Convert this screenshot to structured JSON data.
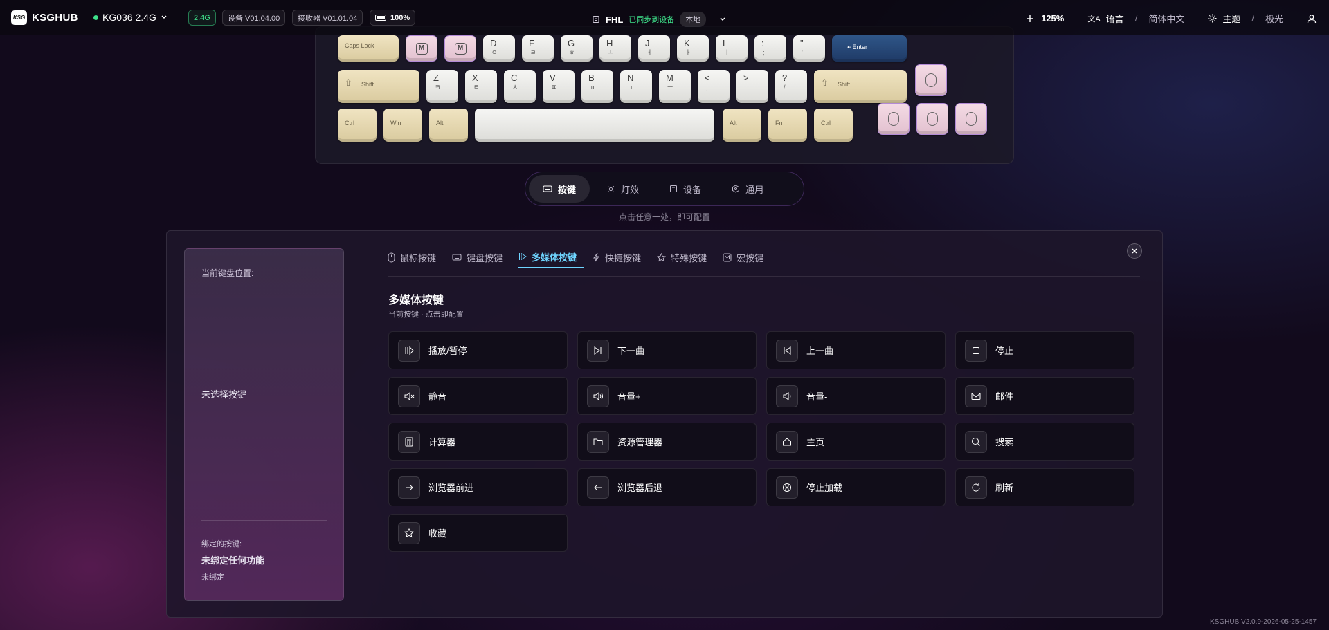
{
  "topbar": {
    "logo": "KSG",
    "brand": "KSGHUB",
    "device": "KG036 2.4G",
    "mode": "2.4G",
    "device_version": "设备 V01.04.00",
    "receiver_version": "接收器 V01.01.04",
    "battery": "100%",
    "profile": "FHL",
    "sync_status": "已同步到设备",
    "location": "本地",
    "zoom": "125%",
    "language_label": "语言",
    "language_value": "简体中文",
    "theme_label": "主题",
    "theme_value": "极光"
  },
  "keyboard": {
    "row1": [
      {
        "t": "Caps Lock"
      },
      {
        "t": "M"
      },
      {
        "t": "M"
      },
      {
        "t": "D",
        "s": "ㅇ"
      },
      {
        "t": "F",
        "s": "ㄹ"
      },
      {
        "t": "G",
        "s": "ㅎ"
      },
      {
        "t": "H",
        "s": "ㅗ"
      },
      {
        "t": "J",
        "s": "ㅓ"
      },
      {
        "t": "K",
        "s": "ㅏ"
      },
      {
        "t": "L",
        "s": "ㅣ"
      },
      {
        "t": ":",
        "s": ";"
      },
      {
        "t": "\"",
        "s": "'"
      },
      {
        "t": "↵Enter"
      }
    ],
    "row2": [
      {
        "t": "Shift"
      },
      {
        "t": "Z",
        "s": "ㅋ"
      },
      {
        "t": "X",
        "s": "ㅌ"
      },
      {
        "t": "C",
        "s": "ㅊ"
      },
      {
        "t": "V",
        "s": "ㅍ"
      },
      {
        "t": "B",
        "s": "ㅠ"
      },
      {
        "t": "N",
        "s": "ㅜ"
      },
      {
        "t": "M",
        "s": "ㅡ"
      },
      {
        "t": "<",
        "s": ","
      },
      {
        "t": ">",
        "s": "."
      },
      {
        "t": "?",
        "s": "/"
      },
      {
        "t": "Shift"
      }
    ],
    "row3": [
      {
        "t": "Ctrl"
      },
      {
        "t": "Win"
      },
      {
        "t": "Alt"
      },
      {
        "t": ""
      },
      {
        "t": "Alt"
      },
      {
        "t": "Fn"
      },
      {
        "t": "Ctrl"
      }
    ]
  },
  "nav": {
    "tabs": [
      "按键",
      "灯效",
      "设备",
      "通用"
    ],
    "hint": "点击任意一处，即可配置"
  },
  "panel": {
    "position_label": "当前键盘位置:",
    "no_selection": "未选择按键",
    "bound_label": "绑定的按键:",
    "bound_value": "未绑定任何功能",
    "bound_status": "未绑定",
    "tabs": [
      "鼠标按键",
      "键盘按键",
      "多媒体按键",
      "快捷按键",
      "特殊按键",
      "宏按键"
    ],
    "section_title": "多媒体按键",
    "section_subtitle": "当前按键 · 点击即配置",
    "buttons": [
      {
        "icon": "play-pause-icon",
        "label": "播放/暂停"
      },
      {
        "icon": "next-track-icon",
        "label": "下一曲"
      },
      {
        "icon": "prev-track-icon",
        "label": "上一曲"
      },
      {
        "icon": "stop-icon",
        "label": "停止"
      },
      {
        "icon": "mute-icon",
        "label": "静音"
      },
      {
        "icon": "volume-up-icon",
        "label": "音量+"
      },
      {
        "icon": "volume-down-icon",
        "label": "音量-"
      },
      {
        "icon": "mail-icon",
        "label": "邮件"
      },
      {
        "icon": "calculator-icon",
        "label": "计算器"
      },
      {
        "icon": "folder-icon",
        "label": "资源管理器"
      },
      {
        "icon": "home-icon",
        "label": "主页"
      },
      {
        "icon": "search-icon",
        "label": "搜索"
      },
      {
        "icon": "arrow-right-icon",
        "label": "浏览器前进"
      },
      {
        "icon": "arrow-left-icon",
        "label": "浏览器后退"
      },
      {
        "icon": "stop-loading-icon",
        "label": "停止加载"
      },
      {
        "icon": "refresh-icon",
        "label": "刷新"
      },
      {
        "icon": "star-icon",
        "label": "收藏"
      }
    ]
  },
  "footer": "KSGHUB V2.0.9-2026-05-25-1457",
  "colors": {
    "accent": "#6fd5ff",
    "online": "#3ee08a",
    "keycap_beige": "#e8dab2",
    "keycap_blue": "#2a4c7e"
  }
}
